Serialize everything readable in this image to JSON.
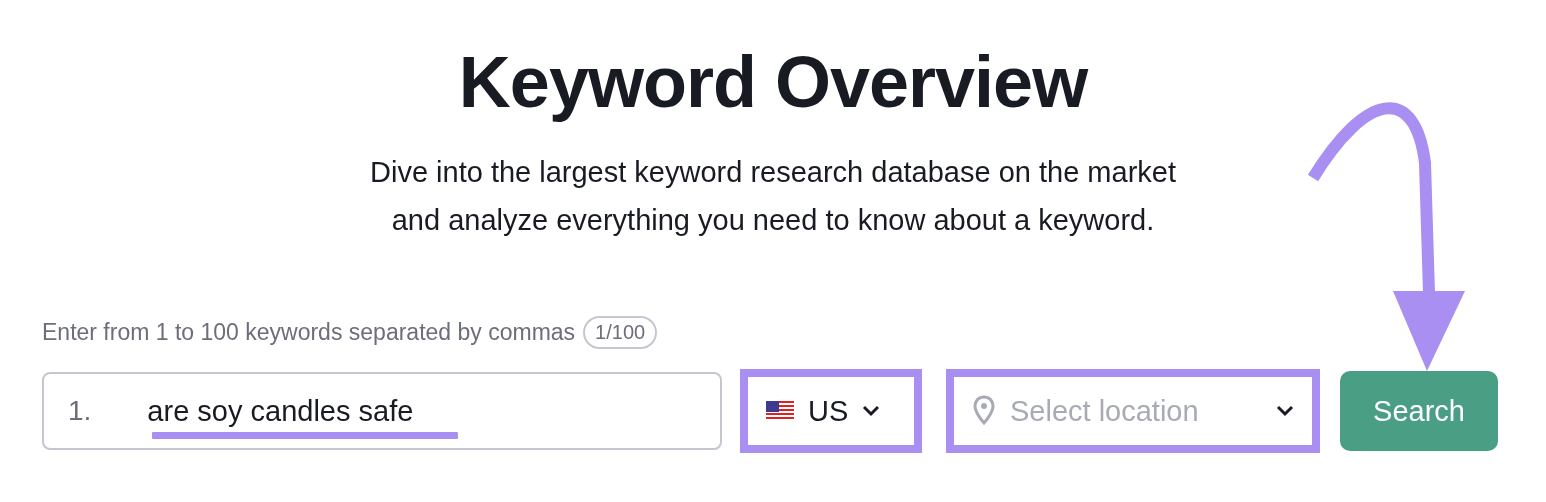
{
  "title": "Keyword Overview",
  "subtitle_lines": [
    "Dive into the largest keyword research database on the market",
    "and analyze everything you need to know about a keyword."
  ],
  "form": {
    "label": "Enter from 1 to 100 keywords separated by commas",
    "counter": "1/100",
    "keyword_field": {
      "line_number": "1.",
      "value": "are soy candles safe"
    },
    "country_select": {
      "value": "US"
    },
    "location_select": {
      "placeholder": "Select location"
    },
    "search_button": "Search"
  }
}
